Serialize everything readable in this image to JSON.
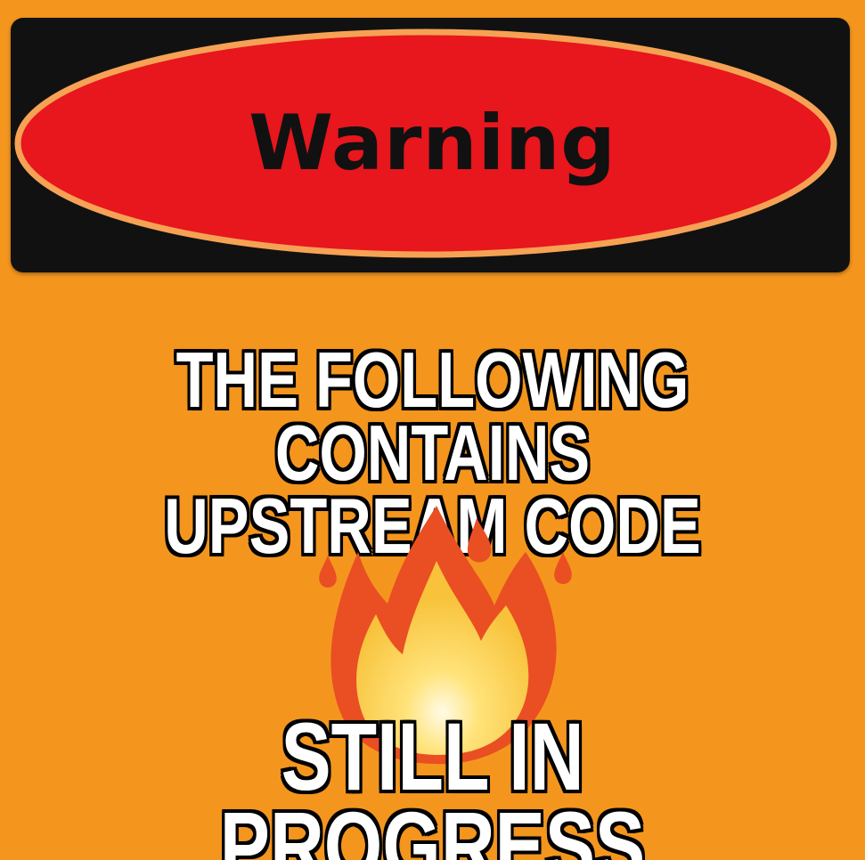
{
  "sign": {
    "header_label": "Warning",
    "top_caption_line1": "THE FOLLOWING CONTAINS",
    "top_caption_line2": "UPSTREAM CODE",
    "bottom_caption": "STILL IN PROGRESS",
    "icon": "fire-icon"
  },
  "colors": {
    "background": "#F4961E",
    "band": "#111111",
    "oval_fill": "#E8161D",
    "oval_border": "#F6A254",
    "caption_text": "#FFFFFF",
    "caption_outline": "#000000"
  }
}
